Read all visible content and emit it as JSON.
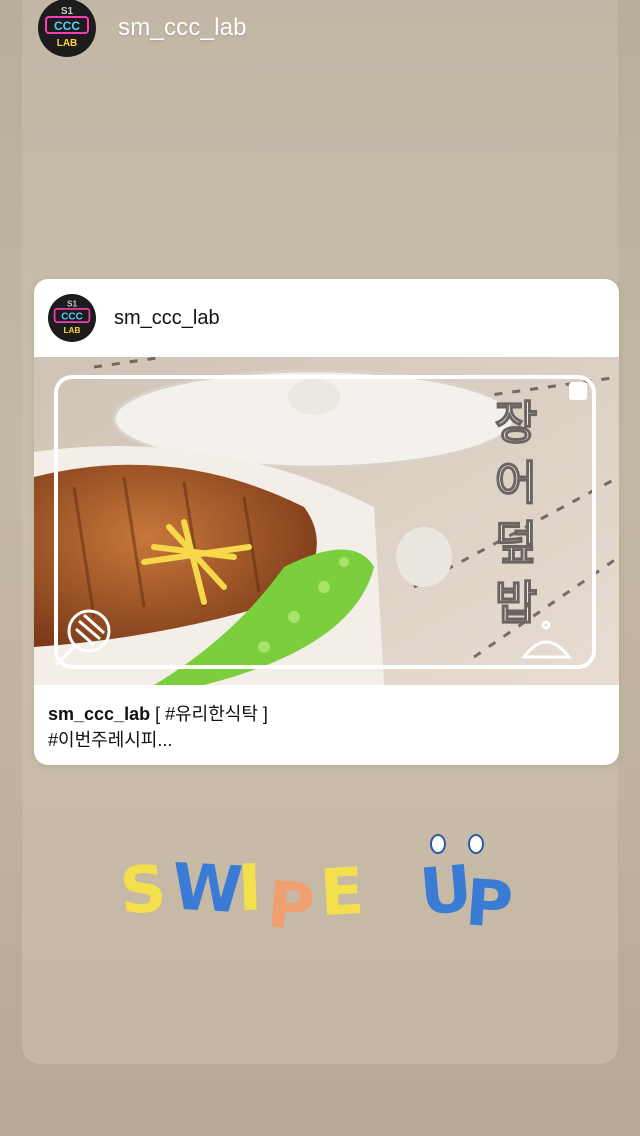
{
  "story": {
    "username": "sm_ccc_lab",
    "logo_text_top": "S1",
    "logo_text_mid": "CCC",
    "logo_text_bot": "LAB"
  },
  "post": {
    "username": "sm_ccc_lab",
    "caption_user": "sm_ccc_lab",
    "caption_tag": "[ #유리한식탁 ]",
    "caption_line2": "#이번주레시피...",
    "image_title": [
      "장",
      "어",
      "덮",
      "밥"
    ]
  },
  "sticker": {
    "text": "SWIPE UP",
    "colors": {
      "yellow": "#f4e04d",
      "blue": "#3a7bd5",
      "orange": "#f0a070"
    }
  }
}
